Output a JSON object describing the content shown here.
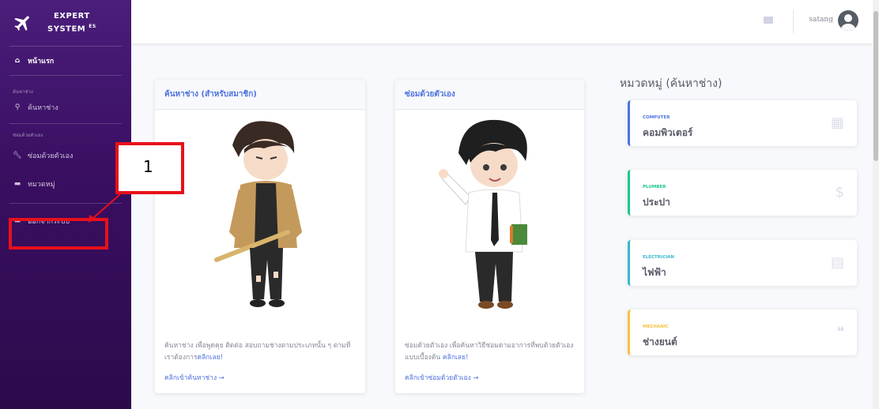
{
  "sidebar": {
    "brand_line1": "EXPERT",
    "brand_line2": "SYSTEM",
    "brand_sup": "ES",
    "home": "หน้าแรก",
    "heading1": "ค้นหาช่าง",
    "search_tech": "ค้นหาช่าง",
    "heading2": "ซ่อมด้วยตัวเอง",
    "self_repair": "ซ่อมด้วยตัวเอง",
    "categories": "หมวดหมู่",
    "logout": "ออกจากระบบ"
  },
  "topbar": {
    "username": "satang"
  },
  "cards": [
    {
      "title": "ค้นหาช่าง (สำหรับสมาชิก)",
      "text": "ค้นหาช่าง เพื่อพูดคุย ติดต่อ สอบถามช่างตามประเภทนั้น ๆ ตามที่เราต้องการ",
      "link_inline": "คลิกเลย!",
      "link": "คลิกเข้าค้นหาช่าง →"
    },
    {
      "title": "ซ่อมด้วยตัวเอง",
      "text": "ซ่อมด้วยตัวเอง เพื่อค้นหาวิธีซ่อมตามอาการที่พบด้วยตัวเองแบบเบื้องต้น",
      "link_inline": "คลิกเลย!",
      "link": "คลิกเข้าซ่อมด้วยตัวเอง →"
    }
  ],
  "categories_title": "หมวดหมู่ (ค้นหาช่าง)",
  "categories": [
    {
      "small": "COMPUTER",
      "big": "คอมพิวเตอร์",
      "color": "#4e73df",
      "icon": "calendar-icon"
    },
    {
      "small": "PLUMBER",
      "big": "ประปา",
      "color": "#1cc88a",
      "icon": "dollar-icon"
    },
    {
      "small": "ELECTRICIAN",
      "big": "ไฟฟ้า",
      "color": "#36b9cc",
      "icon": "clipboard-icon"
    },
    {
      "small": "MECHANIC",
      "big": "ช่างยนต์",
      "color": "#f6c23e",
      "icon": "comments-icon"
    }
  ],
  "annotation": {
    "label": "1"
  }
}
